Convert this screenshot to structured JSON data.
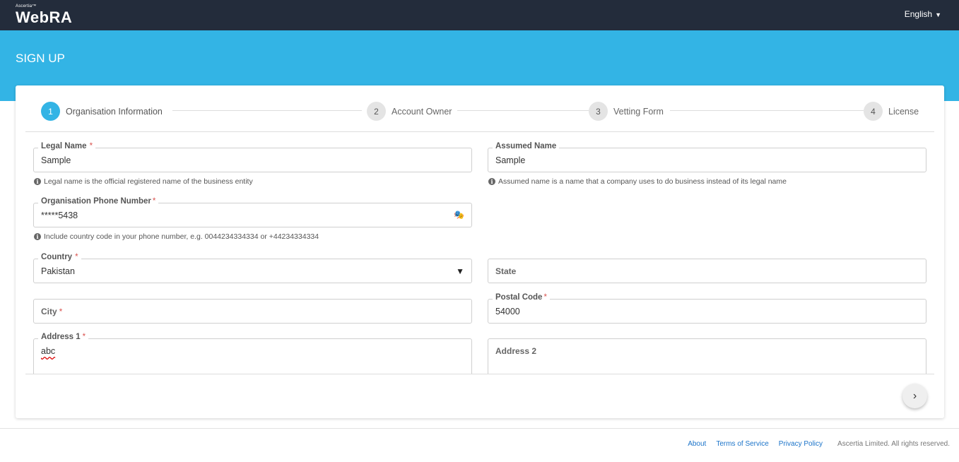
{
  "header": {
    "logo_super": "Ascertia™",
    "logo_main": "WebRA",
    "language": "English"
  },
  "banner": {
    "title": "SIGN UP"
  },
  "stepper": {
    "steps": [
      {
        "number": "1",
        "label": "Organisation Information"
      },
      {
        "number": "2",
        "label": "Account Owner"
      },
      {
        "number": "3",
        "label": "Vetting Form"
      },
      {
        "number": "4",
        "label": "License"
      }
    ]
  },
  "form": {
    "legal_name": {
      "label": "Legal Name",
      "value": "Sample",
      "hint": "Legal name is the official registered name of the business entity"
    },
    "assumed_name": {
      "label": "Assumed Name",
      "value": "Sample",
      "hint": "Assumed name is a name that a company uses to do business instead of its legal name"
    },
    "phone": {
      "label": "Organisation Phone Number",
      "value": "*****5438",
      "hint": "Include country code in your phone number, e.g. 0044234334334 or +44234334334"
    },
    "country": {
      "label": "Country",
      "value": "Pakistan"
    },
    "state": {
      "label": "State"
    },
    "city": {
      "label": "City"
    },
    "postal_code": {
      "label": "Postal Code",
      "value": "54000"
    },
    "address1": {
      "label": "Address 1",
      "value": "abc"
    },
    "address2": {
      "label": "Address 2"
    },
    "required_mark": "*"
  },
  "footer": {
    "about": "About",
    "terms": "Terms of Service",
    "privacy": "Privacy Policy",
    "copyright": "Ascertia Limited. All rights reserved."
  }
}
